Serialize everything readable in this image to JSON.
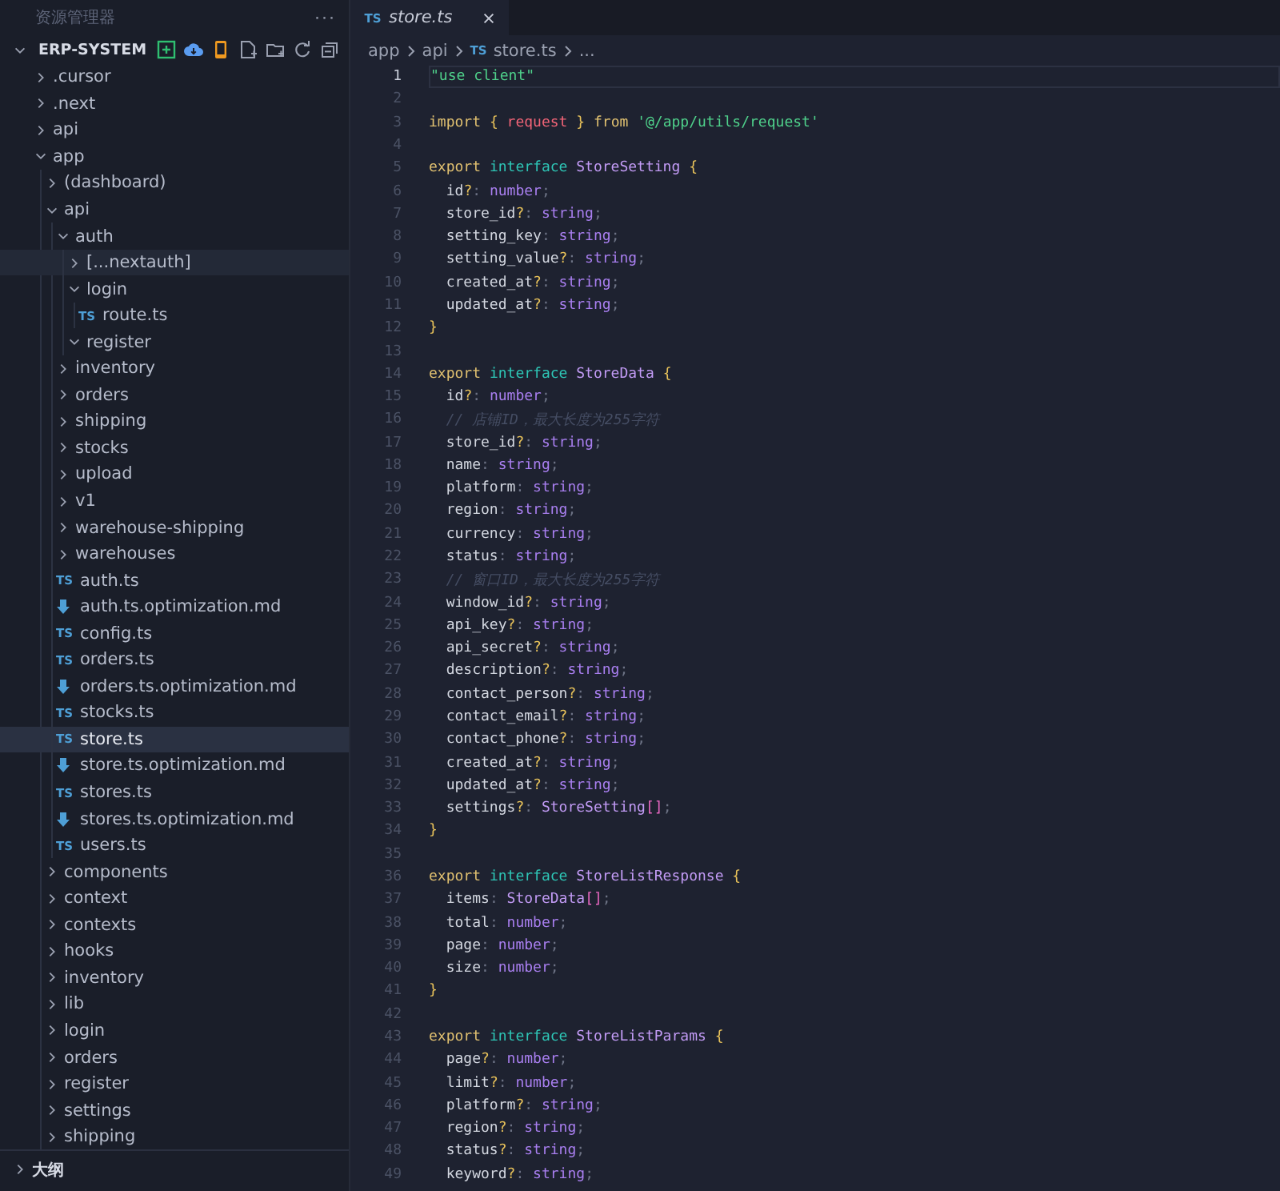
{
  "sidebar": {
    "title": "资源管理器",
    "more": "···",
    "project": {
      "label": "ERP-SYSTEM",
      "expanded": true,
      "items": [
        {
          "label": ".cursor",
          "kind": "folder",
          "expanded": false,
          "selected": false,
          "hovered": false
        },
        {
          "label": ".next",
          "kind": "folder",
          "expanded": false,
          "selected": false,
          "hovered": false
        },
        {
          "label": "api",
          "kind": "folder",
          "expanded": false,
          "selected": false,
          "hovered": false
        },
        {
          "label": "app",
          "kind": "folder",
          "expanded": true,
          "selected": false,
          "hovered": false,
          "children": [
            {
              "label": "(dashboard)",
              "kind": "folder",
              "expanded": false,
              "selected": false,
              "hovered": false
            },
            {
              "label": "api",
              "kind": "folder",
              "expanded": true,
              "selected": false,
              "hovered": false,
              "children": [
                {
                  "label": "auth",
                  "kind": "folder",
                  "expanded": true,
                  "selected": false,
                  "hovered": false,
                  "children": [
                    {
                      "label": "[...nextauth]",
                      "kind": "folder",
                      "expanded": false,
                      "selected": false,
                      "hovered": true
                    },
                    {
                      "label": "login",
                      "kind": "folder",
                      "expanded": true,
                      "selected": false,
                      "hovered": false,
                      "children": [
                        {
                          "label": "route.ts",
                          "kind": "ts",
                          "badge": "TS",
                          "selected": false,
                          "hovered": false
                        }
                      ]
                    },
                    {
                      "label": "register",
                      "kind": "folder",
                      "expanded": true,
                      "selected": false,
                      "hovered": false
                    }
                  ]
                },
                {
                  "label": "inventory",
                  "kind": "folder",
                  "expanded": false,
                  "selected": false,
                  "hovered": false
                },
                {
                  "label": "orders",
                  "kind": "folder",
                  "expanded": false,
                  "selected": false,
                  "hovered": false
                },
                {
                  "label": "shipping",
                  "kind": "folder",
                  "expanded": false,
                  "selected": false,
                  "hovered": false
                },
                {
                  "label": "stocks",
                  "kind": "folder",
                  "expanded": false,
                  "selected": false,
                  "hovered": false
                },
                {
                  "label": "upload",
                  "kind": "folder",
                  "expanded": false,
                  "selected": false,
                  "hovered": false
                },
                {
                  "label": "v1",
                  "kind": "folder",
                  "expanded": false,
                  "selected": false,
                  "hovered": false
                },
                {
                  "label": "warehouse-shipping",
                  "kind": "folder",
                  "expanded": false,
                  "selected": false,
                  "hovered": false
                },
                {
                  "label": "warehouses",
                  "kind": "folder",
                  "expanded": false,
                  "selected": false,
                  "hovered": false
                },
                {
                  "label": "auth.ts",
                  "kind": "ts",
                  "badge": "TS",
                  "selected": false,
                  "hovered": false
                },
                {
                  "label": "auth.ts.optimization.md",
                  "kind": "md",
                  "selected": false,
                  "hovered": false
                },
                {
                  "label": "config.ts",
                  "kind": "ts",
                  "badge": "TS",
                  "selected": false,
                  "hovered": false
                },
                {
                  "label": "orders.ts",
                  "kind": "ts",
                  "badge": "TS",
                  "selected": false,
                  "hovered": false
                },
                {
                  "label": "orders.ts.optimization.md",
                  "kind": "md",
                  "selected": false,
                  "hovered": false
                },
                {
                  "label": "stocks.ts",
                  "kind": "ts",
                  "badge": "TS",
                  "selected": false,
                  "hovered": false
                },
                {
                  "label": "store.ts",
                  "kind": "ts",
                  "badge": "TS",
                  "selected": true,
                  "hovered": false
                },
                {
                  "label": "store.ts.optimization.md",
                  "kind": "md",
                  "selected": false,
                  "hovered": false
                },
                {
                  "label": "stores.ts",
                  "kind": "ts",
                  "badge": "TS",
                  "selected": false,
                  "hovered": false
                },
                {
                  "label": "stores.ts.optimization.md",
                  "kind": "md",
                  "selected": false,
                  "hovered": false
                },
                {
                  "label": "users.ts",
                  "kind": "ts",
                  "badge": "TS",
                  "selected": false,
                  "hovered": false
                }
              ]
            },
            {
              "label": "components",
              "kind": "folder",
              "expanded": false,
              "selected": false,
              "hovered": false
            },
            {
              "label": "context",
              "kind": "folder",
              "expanded": false,
              "selected": false,
              "hovered": false
            },
            {
              "label": "contexts",
              "kind": "folder",
              "expanded": false,
              "selected": false,
              "hovered": false
            },
            {
              "label": "hooks",
              "kind": "folder",
              "expanded": false,
              "selected": false,
              "hovered": false
            },
            {
              "label": "inventory",
              "kind": "folder",
              "expanded": false,
              "selected": false,
              "hovered": false
            },
            {
              "label": "lib",
              "kind": "folder",
              "expanded": false,
              "selected": false,
              "hovered": false
            },
            {
              "label": "login",
              "kind": "folder",
              "expanded": false,
              "selected": false,
              "hovered": false
            },
            {
              "label": "orders",
              "kind": "folder",
              "expanded": false,
              "selected": false,
              "hovered": false
            },
            {
              "label": "register",
              "kind": "folder",
              "expanded": false,
              "selected": false,
              "hovered": false
            },
            {
              "label": "settings",
              "kind": "folder",
              "expanded": false,
              "selected": false,
              "hovered": false
            },
            {
              "label": "shipping",
              "kind": "folder",
              "expanded": false,
              "selected": false,
              "hovered": false
            }
          ]
        }
      ]
    },
    "outline": {
      "label": "大纲",
      "expanded": false
    }
  },
  "editor": {
    "tabs": [
      {
        "badge": "TS",
        "label": "store.ts",
        "selected": true,
        "preview": true
      }
    ],
    "breadcrumb": [
      {
        "label": "app"
      },
      {
        "label": "api"
      },
      {
        "label": "store.ts",
        "badge": "TS"
      },
      {
        "label": "..."
      }
    ],
    "lines": [
      {
        "number": "1",
        "current": true,
        "tokens": [
          {
            "kind": "string",
            "text": "\"use client\""
          }
        ]
      },
      {
        "number": "2",
        "current": false
      },
      {
        "number": "3",
        "current": false,
        "tokens": [
          {
            "kind": "keyword",
            "text": "import "
          },
          {
            "kind": "brace",
            "text": "{ "
          },
          {
            "kind": "variable",
            "text": "request"
          },
          {
            "kind": "brace",
            "text": " }"
          },
          {
            "kind": "keyword",
            "text": " from "
          },
          {
            "kind": "string",
            "text": "'@/app/utils/request'"
          }
        ]
      },
      {
        "number": "4",
        "current": false
      },
      {
        "number": "5",
        "current": false,
        "tokens": [
          {
            "kind": "keyword",
            "text": "export "
          },
          {
            "kind": "interface",
            "text": "interface "
          },
          {
            "kind": "type",
            "text": "StoreSetting"
          },
          {
            "kind": "brace",
            "text": " {"
          }
        ]
      },
      {
        "number": "6",
        "current": false,
        "tokens": [
          {
            "kind": "property",
            "text": "  id"
          },
          {
            "kind": "brace",
            "text": "?"
          },
          {
            "kind": "punct",
            "text": ": "
          },
          {
            "kind": "primitive",
            "text": "number"
          },
          {
            "kind": "punct",
            "text": ";"
          }
        ]
      },
      {
        "number": "7",
        "current": false,
        "tokens": [
          {
            "kind": "property",
            "text": "  store_id"
          },
          {
            "kind": "brace",
            "text": "?"
          },
          {
            "kind": "punct",
            "text": ": "
          },
          {
            "kind": "primitive",
            "text": "string"
          },
          {
            "kind": "punct",
            "text": ";"
          }
        ]
      },
      {
        "number": "8",
        "current": false,
        "tokens": [
          {
            "kind": "property",
            "text": "  setting_key"
          },
          {
            "kind": "punct",
            "text": ": "
          },
          {
            "kind": "primitive",
            "text": "string"
          },
          {
            "kind": "punct",
            "text": ";"
          }
        ]
      },
      {
        "number": "9",
        "current": false,
        "tokens": [
          {
            "kind": "property",
            "text": "  setting_value"
          },
          {
            "kind": "brace",
            "text": "?"
          },
          {
            "kind": "punct",
            "text": ": "
          },
          {
            "kind": "primitive",
            "text": "string"
          },
          {
            "kind": "punct",
            "text": ";"
          }
        ]
      },
      {
        "number": "10",
        "current": false,
        "tokens": [
          {
            "kind": "property",
            "text": "  created_at"
          },
          {
            "kind": "brace",
            "text": "?"
          },
          {
            "kind": "punct",
            "text": ": "
          },
          {
            "kind": "primitive",
            "text": "string"
          },
          {
            "kind": "punct",
            "text": ";"
          }
        ]
      },
      {
        "number": "11",
        "current": false,
        "tokens": [
          {
            "kind": "property",
            "text": "  updated_at"
          },
          {
            "kind": "brace",
            "text": "?"
          },
          {
            "kind": "punct",
            "text": ": "
          },
          {
            "kind": "primitive",
            "text": "string"
          },
          {
            "kind": "punct",
            "text": ";"
          }
        ]
      },
      {
        "number": "12",
        "current": false,
        "tokens": [
          {
            "kind": "brace",
            "text": "}"
          }
        ]
      },
      {
        "number": "13",
        "current": false
      },
      {
        "number": "14",
        "current": false,
        "tokens": [
          {
            "kind": "keyword",
            "text": "export "
          },
          {
            "kind": "interface",
            "text": "interface "
          },
          {
            "kind": "type",
            "text": "StoreData"
          },
          {
            "kind": "brace",
            "text": " {"
          }
        ]
      },
      {
        "number": "15",
        "current": false,
        "tokens": [
          {
            "kind": "property",
            "text": "  id"
          },
          {
            "kind": "brace",
            "text": "?"
          },
          {
            "kind": "punct",
            "text": ": "
          },
          {
            "kind": "primitive",
            "text": "number"
          },
          {
            "kind": "punct",
            "text": ";"
          }
        ]
      },
      {
        "number": "16",
        "current": false,
        "tokens": [
          {
            "kind": "comment",
            "text": "  // 店铺ID，最大长度为255字符"
          }
        ]
      },
      {
        "number": "17",
        "current": false,
        "tokens": [
          {
            "kind": "property",
            "text": "  store_id"
          },
          {
            "kind": "brace",
            "text": "?"
          },
          {
            "kind": "punct",
            "text": ": "
          },
          {
            "kind": "primitive",
            "text": "string"
          },
          {
            "kind": "punct",
            "text": ";"
          }
        ]
      },
      {
        "number": "18",
        "current": false,
        "tokens": [
          {
            "kind": "property",
            "text": "  name"
          },
          {
            "kind": "punct",
            "text": ": "
          },
          {
            "kind": "primitive",
            "text": "string"
          },
          {
            "kind": "punct",
            "text": ";"
          }
        ]
      },
      {
        "number": "19",
        "current": false,
        "tokens": [
          {
            "kind": "property",
            "text": "  platform"
          },
          {
            "kind": "punct",
            "text": ": "
          },
          {
            "kind": "primitive",
            "text": "string"
          },
          {
            "kind": "punct",
            "text": ";"
          }
        ]
      },
      {
        "number": "20",
        "current": false,
        "tokens": [
          {
            "kind": "property",
            "text": "  region"
          },
          {
            "kind": "punct",
            "text": ": "
          },
          {
            "kind": "primitive",
            "text": "string"
          },
          {
            "kind": "punct",
            "text": ";"
          }
        ]
      },
      {
        "number": "21",
        "current": false,
        "tokens": [
          {
            "kind": "property",
            "text": "  currency"
          },
          {
            "kind": "punct",
            "text": ": "
          },
          {
            "kind": "primitive",
            "text": "string"
          },
          {
            "kind": "punct",
            "text": ";"
          }
        ]
      },
      {
        "number": "22",
        "current": false,
        "tokens": [
          {
            "kind": "property",
            "text": "  status"
          },
          {
            "kind": "punct",
            "text": ": "
          },
          {
            "kind": "primitive",
            "text": "string"
          },
          {
            "kind": "punct",
            "text": ";"
          }
        ]
      },
      {
        "number": "23",
        "current": false,
        "tokens": [
          {
            "kind": "comment",
            "text": "  // 窗口ID，最大长度为255字符"
          }
        ]
      },
      {
        "number": "24",
        "current": false,
        "tokens": [
          {
            "kind": "property",
            "text": "  window_id"
          },
          {
            "kind": "brace",
            "text": "?"
          },
          {
            "kind": "punct",
            "text": ": "
          },
          {
            "kind": "primitive",
            "text": "string"
          },
          {
            "kind": "punct",
            "text": ";"
          }
        ]
      },
      {
        "number": "25",
        "current": false,
        "tokens": [
          {
            "kind": "property",
            "text": "  api_key"
          },
          {
            "kind": "brace",
            "text": "?"
          },
          {
            "kind": "punct",
            "text": ": "
          },
          {
            "kind": "primitive",
            "text": "string"
          },
          {
            "kind": "punct",
            "text": ";"
          }
        ]
      },
      {
        "number": "26",
        "current": false,
        "tokens": [
          {
            "kind": "property",
            "text": "  api_secret"
          },
          {
            "kind": "brace",
            "text": "?"
          },
          {
            "kind": "punct",
            "text": ": "
          },
          {
            "kind": "primitive",
            "text": "string"
          },
          {
            "kind": "punct",
            "text": ";"
          }
        ]
      },
      {
        "number": "27",
        "current": false,
        "tokens": [
          {
            "kind": "property",
            "text": "  description"
          },
          {
            "kind": "brace",
            "text": "?"
          },
          {
            "kind": "punct",
            "text": ": "
          },
          {
            "kind": "primitive",
            "text": "string"
          },
          {
            "kind": "punct",
            "text": ";"
          }
        ]
      },
      {
        "number": "28",
        "current": false,
        "tokens": [
          {
            "kind": "property",
            "text": "  contact_person"
          },
          {
            "kind": "brace",
            "text": "?"
          },
          {
            "kind": "punct",
            "text": ": "
          },
          {
            "kind": "primitive",
            "text": "string"
          },
          {
            "kind": "punct",
            "text": ";"
          }
        ]
      },
      {
        "number": "29",
        "current": false,
        "tokens": [
          {
            "kind": "property",
            "text": "  contact_email"
          },
          {
            "kind": "brace",
            "text": "?"
          },
          {
            "kind": "punct",
            "text": ": "
          },
          {
            "kind": "primitive",
            "text": "string"
          },
          {
            "kind": "punct",
            "text": ";"
          }
        ]
      },
      {
        "number": "30",
        "current": false,
        "tokens": [
          {
            "kind": "property",
            "text": "  contact_phone"
          },
          {
            "kind": "brace",
            "text": "?"
          },
          {
            "kind": "punct",
            "text": ": "
          },
          {
            "kind": "primitive",
            "text": "string"
          },
          {
            "kind": "punct",
            "text": ";"
          }
        ]
      },
      {
        "number": "31",
        "current": false,
        "tokens": [
          {
            "kind": "property",
            "text": "  created_at"
          },
          {
            "kind": "brace",
            "text": "?"
          },
          {
            "kind": "punct",
            "text": ": "
          },
          {
            "kind": "primitive",
            "text": "string"
          },
          {
            "kind": "punct",
            "text": ";"
          }
        ]
      },
      {
        "number": "32",
        "current": false,
        "tokens": [
          {
            "kind": "property",
            "text": "  updated_at"
          },
          {
            "kind": "brace",
            "text": "?"
          },
          {
            "kind": "punct",
            "text": ": "
          },
          {
            "kind": "primitive",
            "text": "string"
          },
          {
            "kind": "punct",
            "text": ";"
          }
        ]
      },
      {
        "number": "33",
        "current": false,
        "tokens": [
          {
            "kind": "property",
            "text": "  settings"
          },
          {
            "kind": "brace",
            "text": "?"
          },
          {
            "kind": "punct",
            "text": ": "
          },
          {
            "kind": "type",
            "text": "StoreSetting"
          },
          {
            "kind": "bracket",
            "text": "[]"
          },
          {
            "kind": "punct",
            "text": ";"
          }
        ]
      },
      {
        "number": "34",
        "current": false,
        "tokens": [
          {
            "kind": "brace",
            "text": "}"
          }
        ]
      },
      {
        "number": "35",
        "current": false
      },
      {
        "number": "36",
        "current": false,
        "tokens": [
          {
            "kind": "keyword",
            "text": "export "
          },
          {
            "kind": "interface",
            "text": "interface "
          },
          {
            "kind": "type",
            "text": "StoreListResponse"
          },
          {
            "kind": "brace",
            "text": " {"
          }
        ]
      },
      {
        "number": "37",
        "current": false,
        "tokens": [
          {
            "kind": "property",
            "text": "  items"
          },
          {
            "kind": "punct",
            "text": ": "
          },
          {
            "kind": "type",
            "text": "StoreData"
          },
          {
            "kind": "bracket",
            "text": "[]"
          },
          {
            "kind": "punct",
            "text": ";"
          }
        ]
      },
      {
        "number": "38",
        "current": false,
        "tokens": [
          {
            "kind": "property",
            "text": "  total"
          },
          {
            "kind": "punct",
            "text": ": "
          },
          {
            "kind": "primitive",
            "text": "number"
          },
          {
            "kind": "punct",
            "text": ";"
          }
        ]
      },
      {
        "number": "39",
        "current": false,
        "tokens": [
          {
            "kind": "property",
            "text": "  page"
          },
          {
            "kind": "punct",
            "text": ": "
          },
          {
            "kind": "primitive",
            "text": "number"
          },
          {
            "kind": "punct",
            "text": ";"
          }
        ]
      },
      {
        "number": "40",
        "current": false,
        "tokens": [
          {
            "kind": "property",
            "text": "  size"
          },
          {
            "kind": "punct",
            "text": ": "
          },
          {
            "kind": "primitive",
            "text": "number"
          },
          {
            "kind": "punct",
            "text": ";"
          }
        ]
      },
      {
        "number": "41",
        "current": false,
        "tokens": [
          {
            "kind": "brace",
            "text": "}"
          }
        ]
      },
      {
        "number": "42",
        "current": false
      },
      {
        "number": "43",
        "current": false,
        "tokens": [
          {
            "kind": "keyword",
            "text": "export "
          },
          {
            "kind": "interface",
            "text": "interface "
          },
          {
            "kind": "type",
            "text": "StoreListParams"
          },
          {
            "kind": "brace",
            "text": " {"
          }
        ]
      },
      {
        "number": "44",
        "current": false,
        "tokens": [
          {
            "kind": "property",
            "text": "  page"
          },
          {
            "kind": "brace",
            "text": "?"
          },
          {
            "kind": "punct",
            "text": ": "
          },
          {
            "kind": "primitive",
            "text": "number"
          },
          {
            "kind": "punct",
            "text": ";"
          }
        ]
      },
      {
        "number": "45",
        "current": false,
        "tokens": [
          {
            "kind": "property",
            "text": "  limit"
          },
          {
            "kind": "brace",
            "text": "?"
          },
          {
            "kind": "punct",
            "text": ": "
          },
          {
            "kind": "primitive",
            "text": "number"
          },
          {
            "kind": "punct",
            "text": ";"
          }
        ]
      },
      {
        "number": "46",
        "current": false,
        "tokens": [
          {
            "kind": "property",
            "text": "  platform"
          },
          {
            "kind": "brace",
            "text": "?"
          },
          {
            "kind": "punct",
            "text": ": "
          },
          {
            "kind": "primitive",
            "text": "string"
          },
          {
            "kind": "punct",
            "text": ";"
          }
        ]
      },
      {
        "number": "47",
        "current": false,
        "tokens": [
          {
            "kind": "property",
            "text": "  region"
          },
          {
            "kind": "brace",
            "text": "?"
          },
          {
            "kind": "punct",
            "text": ": "
          },
          {
            "kind": "primitive",
            "text": "string"
          },
          {
            "kind": "punct",
            "text": ";"
          }
        ]
      },
      {
        "number": "48",
        "current": false,
        "tokens": [
          {
            "kind": "property",
            "text": "  status"
          },
          {
            "kind": "brace",
            "text": "?"
          },
          {
            "kind": "punct",
            "text": ": "
          },
          {
            "kind": "primitive",
            "text": "string"
          },
          {
            "kind": "punct",
            "text": ";"
          }
        ]
      },
      {
        "number": "49",
        "current": false,
        "tokens": [
          {
            "kind": "property",
            "text": "  keyword"
          },
          {
            "kind": "brace",
            "text": "?"
          },
          {
            "kind": "punct",
            "text": ": "
          },
          {
            "kind": "primitive",
            "text": "string"
          },
          {
            "kind": "punct",
            "text": ";"
          }
        ]
      }
    ]
  }
}
